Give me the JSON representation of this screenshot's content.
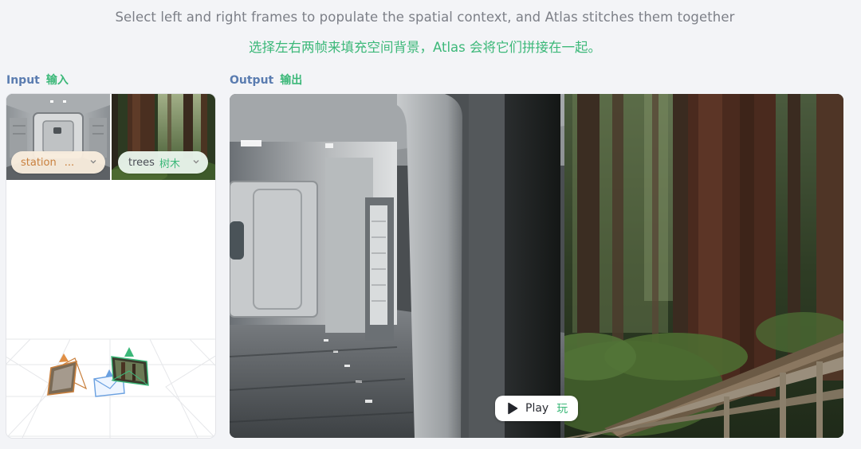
{
  "header": {
    "subtitle_en": "Select left and right frames to populate the spatial context, and Atlas stitches them together",
    "subtitle_zh": "选择左右两帧来填充空间背景，Atlas 会将它们拼接在一起。"
  },
  "input": {
    "label_en": "Input",
    "label_zh": "输入",
    "left_frame": {
      "value": "station",
      "truncation": "..."
    },
    "right_frame": {
      "value": "trees",
      "value_zh": "树木"
    },
    "thumbnails": [
      "space-station-corridor",
      "redwood-forest"
    ]
  },
  "output": {
    "label_en": "Output",
    "label_zh": "输出",
    "play_label": "Play",
    "play_label_zh": "玩"
  },
  "colors": {
    "accent_green": "#3cb879",
    "label_blue": "#5a7cb0",
    "left_frame_orange": "#c9803e",
    "right_frame_green": "#3cb879",
    "center_frame_blue": "#6aa0e0"
  }
}
